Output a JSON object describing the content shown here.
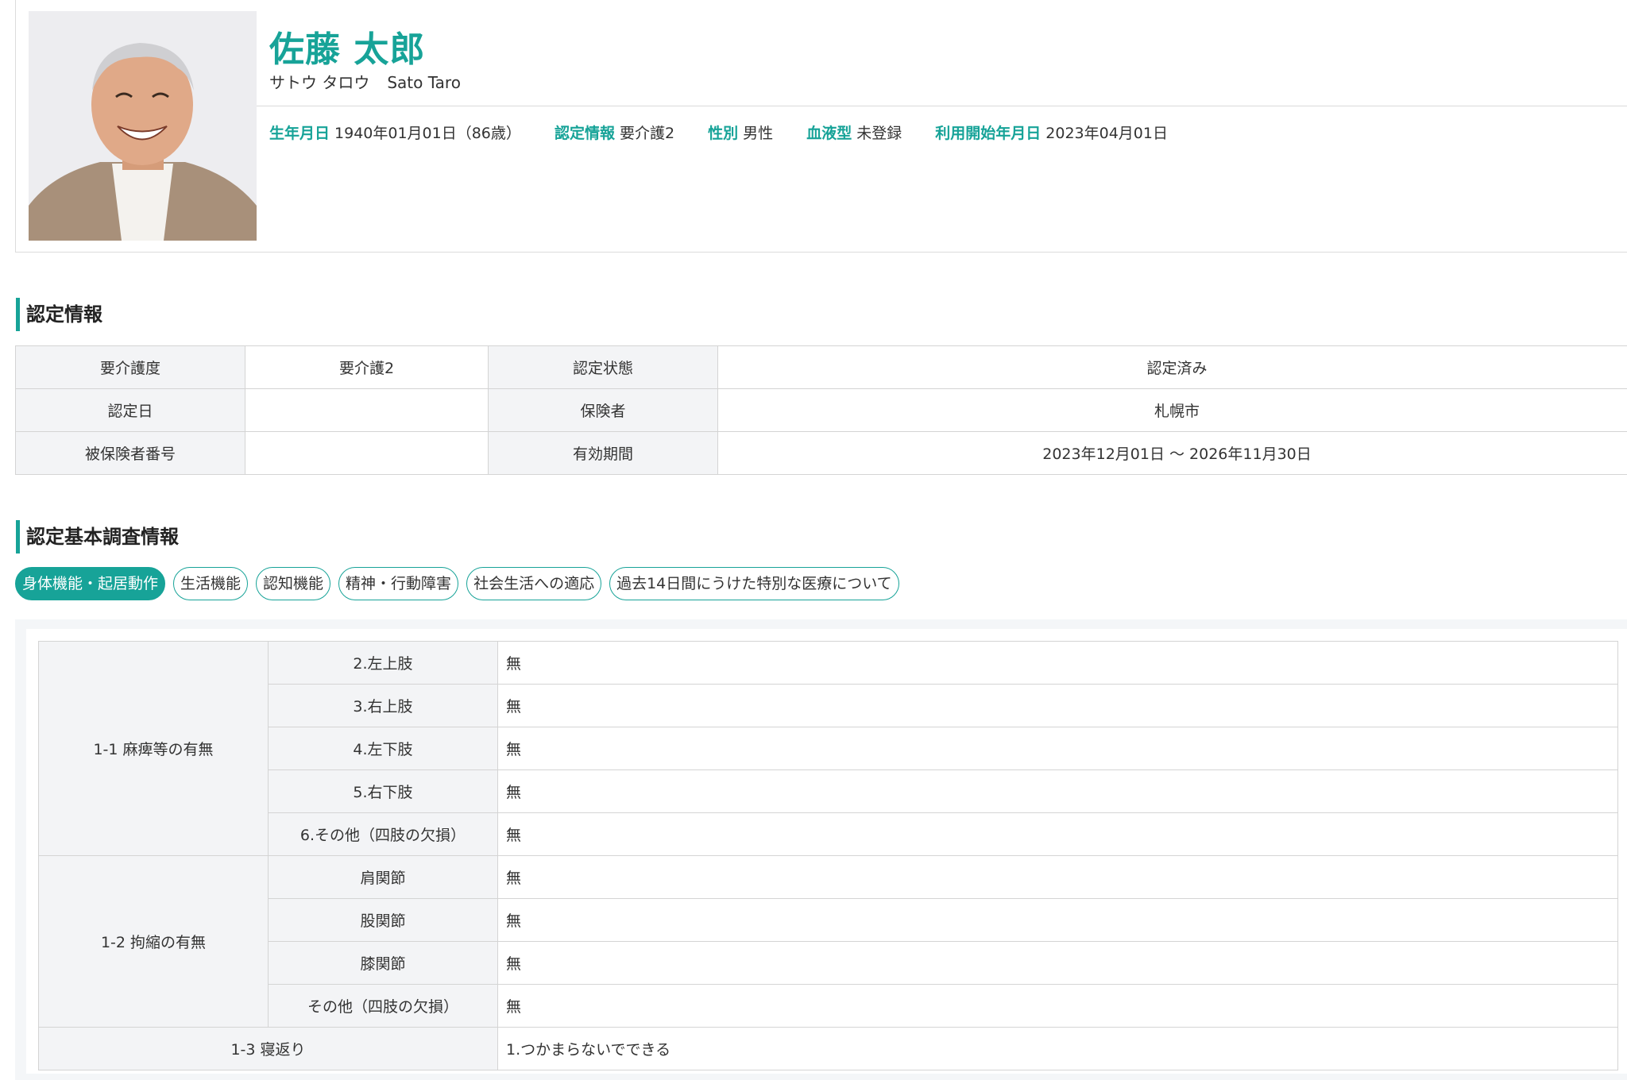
{
  "profile": {
    "name": "佐藤 太郎",
    "kana": "サトウ タロウ",
    "romaji": "Sato Taro",
    "photo_alt": "avatar-photo",
    "info": [
      {
        "label": "生年月日",
        "value": "1940年01月01日（86歳）"
      },
      {
        "label": "認定情報",
        "value": "要介護2"
      },
      {
        "label": "性別",
        "value": "男性"
      },
      {
        "label": "血液型",
        "value": "未登録"
      },
      {
        "label": "利用開始年月日",
        "value": "2023年04月01日"
      }
    ]
  },
  "certification": {
    "title": "認定情報",
    "rows": [
      [
        "要介護度",
        "要介護2",
        "認定状態",
        "認定済み"
      ],
      [
        "認定日",
        "",
        "保険者",
        "札幌市"
      ],
      [
        "被保険者番号",
        "",
        "有効期間",
        "2023年12月01日 〜 2026年11月30日"
      ]
    ]
  },
  "survey": {
    "title": "認定基本調査情報",
    "tabs": [
      "身体機能・起居動作",
      "生活機能",
      "認知機能",
      "精神・行動障害",
      "社会生活への適応",
      "過去14日間にうけた特別な医療について"
    ],
    "active_tab": 0,
    "groups": [
      {
        "label": "1-1 麻痺等の有無",
        "items": [
          {
            "label": "2.左上肢",
            "value": "無"
          },
          {
            "label": "3.右上肢",
            "value": "無"
          },
          {
            "label": "4.左下肢",
            "value": "無"
          },
          {
            "label": "5.右下肢",
            "value": "無"
          },
          {
            "label": "6.その他（四肢の欠損）",
            "value": "無"
          }
        ]
      },
      {
        "label": "1-2 拘縮の有無",
        "items": [
          {
            "label": "肩関節",
            "value": "無"
          },
          {
            "label": "股関節",
            "value": "無"
          },
          {
            "label": "膝関節",
            "value": "無"
          },
          {
            "label": "その他（四肢の欠損）",
            "value": "無"
          }
        ]
      }
    ],
    "single": {
      "label": "1-3 寝返り",
      "value": "1.つかまらないでできる"
    }
  }
}
